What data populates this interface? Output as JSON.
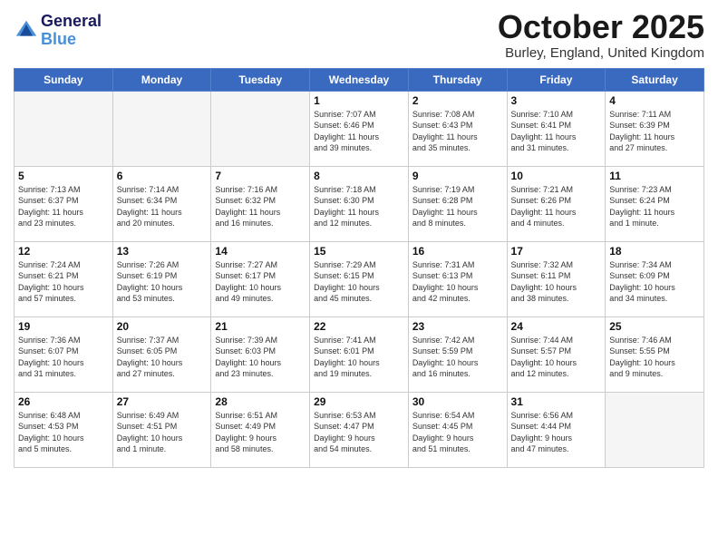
{
  "header": {
    "logo_line1": "General",
    "logo_line2": "Blue",
    "month": "October 2025",
    "location": "Burley, England, United Kingdom"
  },
  "days_of_week": [
    "Sunday",
    "Monday",
    "Tuesday",
    "Wednesday",
    "Thursday",
    "Friday",
    "Saturday"
  ],
  "weeks": [
    [
      {
        "day": "",
        "info": ""
      },
      {
        "day": "",
        "info": ""
      },
      {
        "day": "",
        "info": ""
      },
      {
        "day": "1",
        "info": "Sunrise: 7:07 AM\nSunset: 6:46 PM\nDaylight: 11 hours\nand 39 minutes."
      },
      {
        "day": "2",
        "info": "Sunrise: 7:08 AM\nSunset: 6:43 PM\nDaylight: 11 hours\nand 35 minutes."
      },
      {
        "day": "3",
        "info": "Sunrise: 7:10 AM\nSunset: 6:41 PM\nDaylight: 11 hours\nand 31 minutes."
      },
      {
        "day": "4",
        "info": "Sunrise: 7:11 AM\nSunset: 6:39 PM\nDaylight: 11 hours\nand 27 minutes."
      }
    ],
    [
      {
        "day": "5",
        "info": "Sunrise: 7:13 AM\nSunset: 6:37 PM\nDaylight: 11 hours\nand 23 minutes."
      },
      {
        "day": "6",
        "info": "Sunrise: 7:14 AM\nSunset: 6:34 PM\nDaylight: 11 hours\nand 20 minutes."
      },
      {
        "day": "7",
        "info": "Sunrise: 7:16 AM\nSunset: 6:32 PM\nDaylight: 11 hours\nand 16 minutes."
      },
      {
        "day": "8",
        "info": "Sunrise: 7:18 AM\nSunset: 6:30 PM\nDaylight: 11 hours\nand 12 minutes."
      },
      {
        "day": "9",
        "info": "Sunrise: 7:19 AM\nSunset: 6:28 PM\nDaylight: 11 hours\nand 8 minutes."
      },
      {
        "day": "10",
        "info": "Sunrise: 7:21 AM\nSunset: 6:26 PM\nDaylight: 11 hours\nand 4 minutes."
      },
      {
        "day": "11",
        "info": "Sunrise: 7:23 AM\nSunset: 6:24 PM\nDaylight: 11 hours\nand 1 minute."
      }
    ],
    [
      {
        "day": "12",
        "info": "Sunrise: 7:24 AM\nSunset: 6:21 PM\nDaylight: 10 hours\nand 57 minutes."
      },
      {
        "day": "13",
        "info": "Sunrise: 7:26 AM\nSunset: 6:19 PM\nDaylight: 10 hours\nand 53 minutes."
      },
      {
        "day": "14",
        "info": "Sunrise: 7:27 AM\nSunset: 6:17 PM\nDaylight: 10 hours\nand 49 minutes."
      },
      {
        "day": "15",
        "info": "Sunrise: 7:29 AM\nSunset: 6:15 PM\nDaylight: 10 hours\nand 45 minutes."
      },
      {
        "day": "16",
        "info": "Sunrise: 7:31 AM\nSunset: 6:13 PM\nDaylight: 10 hours\nand 42 minutes."
      },
      {
        "day": "17",
        "info": "Sunrise: 7:32 AM\nSunset: 6:11 PM\nDaylight: 10 hours\nand 38 minutes."
      },
      {
        "day": "18",
        "info": "Sunrise: 7:34 AM\nSunset: 6:09 PM\nDaylight: 10 hours\nand 34 minutes."
      }
    ],
    [
      {
        "day": "19",
        "info": "Sunrise: 7:36 AM\nSunset: 6:07 PM\nDaylight: 10 hours\nand 31 minutes."
      },
      {
        "day": "20",
        "info": "Sunrise: 7:37 AM\nSunset: 6:05 PM\nDaylight: 10 hours\nand 27 minutes."
      },
      {
        "day": "21",
        "info": "Sunrise: 7:39 AM\nSunset: 6:03 PM\nDaylight: 10 hours\nand 23 minutes."
      },
      {
        "day": "22",
        "info": "Sunrise: 7:41 AM\nSunset: 6:01 PM\nDaylight: 10 hours\nand 19 minutes."
      },
      {
        "day": "23",
        "info": "Sunrise: 7:42 AM\nSunset: 5:59 PM\nDaylight: 10 hours\nand 16 minutes."
      },
      {
        "day": "24",
        "info": "Sunrise: 7:44 AM\nSunset: 5:57 PM\nDaylight: 10 hours\nand 12 minutes."
      },
      {
        "day": "25",
        "info": "Sunrise: 7:46 AM\nSunset: 5:55 PM\nDaylight: 10 hours\nand 9 minutes."
      }
    ],
    [
      {
        "day": "26",
        "info": "Sunrise: 6:48 AM\nSunset: 4:53 PM\nDaylight: 10 hours\nand 5 minutes."
      },
      {
        "day": "27",
        "info": "Sunrise: 6:49 AM\nSunset: 4:51 PM\nDaylight: 10 hours\nand 1 minute."
      },
      {
        "day": "28",
        "info": "Sunrise: 6:51 AM\nSunset: 4:49 PM\nDaylight: 9 hours\nand 58 minutes."
      },
      {
        "day": "29",
        "info": "Sunrise: 6:53 AM\nSunset: 4:47 PM\nDaylight: 9 hours\nand 54 minutes."
      },
      {
        "day": "30",
        "info": "Sunrise: 6:54 AM\nSunset: 4:45 PM\nDaylight: 9 hours\nand 51 minutes."
      },
      {
        "day": "31",
        "info": "Sunrise: 6:56 AM\nSunset: 4:44 PM\nDaylight: 9 hours\nand 47 minutes."
      },
      {
        "day": "",
        "info": ""
      }
    ]
  ]
}
